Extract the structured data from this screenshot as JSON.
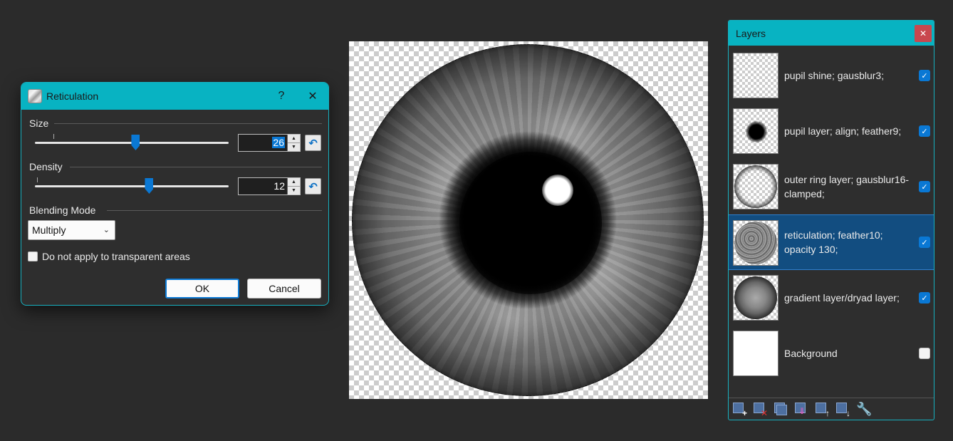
{
  "dialog": {
    "title": "Reticulation",
    "help_label": "?",
    "close_label": "✕",
    "size": {
      "label": "Size",
      "value": "26",
      "min": 0,
      "max": 100,
      "level": 0.52
    },
    "density": {
      "label": "Density",
      "value": "12",
      "level": 0.59
    },
    "blending": {
      "label": "Blending Mode",
      "selected": "Multiply"
    },
    "transparent_option": {
      "label": "Do not apply to transparent areas",
      "checked": false
    },
    "ok_label": "OK",
    "cancel_label": "Cancel"
  },
  "layers_panel": {
    "title": "Layers",
    "close_label": "✕",
    "items": [
      {
        "name": "pupil shine; gausblur3;",
        "visible": true,
        "selected": false
      },
      {
        "name": "pupil layer; align; feather9;",
        "visible": true,
        "selected": false
      },
      {
        "name": "outer ring layer; gausblur16-clamped;",
        "visible": true,
        "selected": false
      },
      {
        "name": "reticulation; feather10; opacity 130;",
        "visible": true,
        "selected": true
      },
      {
        "name": "gradient layer/dryad layer;",
        "visible": true,
        "selected": false
      },
      {
        "name": "Background",
        "visible": false,
        "selected": false
      }
    ],
    "toolbar": [
      "add-layer-icon",
      "delete-layer-icon",
      "duplicate-layer-icon",
      "merge-layer-down-icon",
      "move-layer-up-icon",
      "move-layer-down-icon",
      "layer-properties-icon"
    ]
  },
  "colors": {
    "accent": "#08b3c2",
    "selection": "#124d80",
    "primary": "#0a78d4"
  }
}
